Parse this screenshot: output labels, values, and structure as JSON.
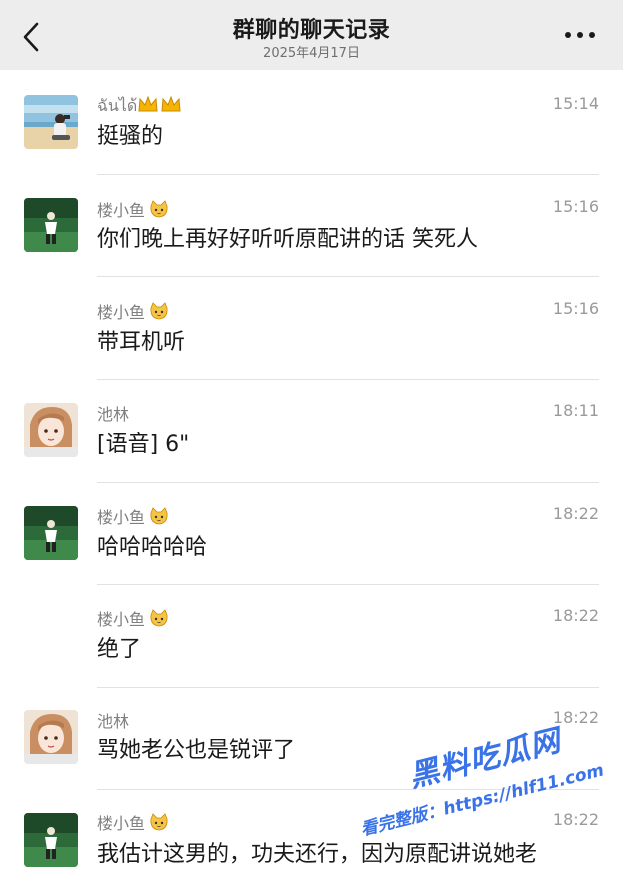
{
  "header": {
    "title": "群聊的聊天记录",
    "date": "2025年4月17日",
    "back_icon": "chevron-left-icon",
    "more_icon": "more-dots-icon"
  },
  "messages": [
    {
      "sender": "ฉันได้",
      "badge": "crown-crown",
      "time": "15:14",
      "text": "挺骚的",
      "show_avatar": true,
      "avatar": "beach-avatar"
    },
    {
      "sender": "楼小鱼",
      "badge": "cat",
      "time": "15:16",
      "text": "你们晚上再好好听听原配讲的话 笑死人",
      "show_avatar": true,
      "avatar": "green-field-avatar"
    },
    {
      "sender": "楼小鱼",
      "badge": "cat",
      "time": "15:16",
      "text": "带耳机听",
      "show_avatar": false
    },
    {
      "sender": "池林",
      "badge": "",
      "time": "18:11",
      "text": "[语音] 6\"",
      "show_avatar": true,
      "avatar": "anime-girl-avatar"
    },
    {
      "sender": "楼小鱼",
      "badge": "cat",
      "time": "18:22",
      "text": "哈哈哈哈哈",
      "show_avatar": true,
      "avatar": "green-field-avatar"
    },
    {
      "sender": "楼小鱼",
      "badge": "cat",
      "time": "18:22",
      "text": "绝了",
      "show_avatar": false
    },
    {
      "sender": "池林",
      "badge": "",
      "time": "18:22",
      "text": "骂她老公也是锐评了",
      "show_avatar": true,
      "avatar": "anime-girl-avatar"
    },
    {
      "sender": "楼小鱼",
      "badge": "cat",
      "time": "18:22",
      "text": "我估计这男的，功夫还行，因为原配讲说她老",
      "show_avatar": true,
      "avatar": "green-field-avatar"
    }
  ],
  "watermark": {
    "title": "黑料吃瓜网",
    "subtitle": "看完整版：https://hlf11.com"
  },
  "colors": {
    "header_bg": "#ededed",
    "divider": "#e2e2e2",
    "watermark": "#3a73e8"
  }
}
